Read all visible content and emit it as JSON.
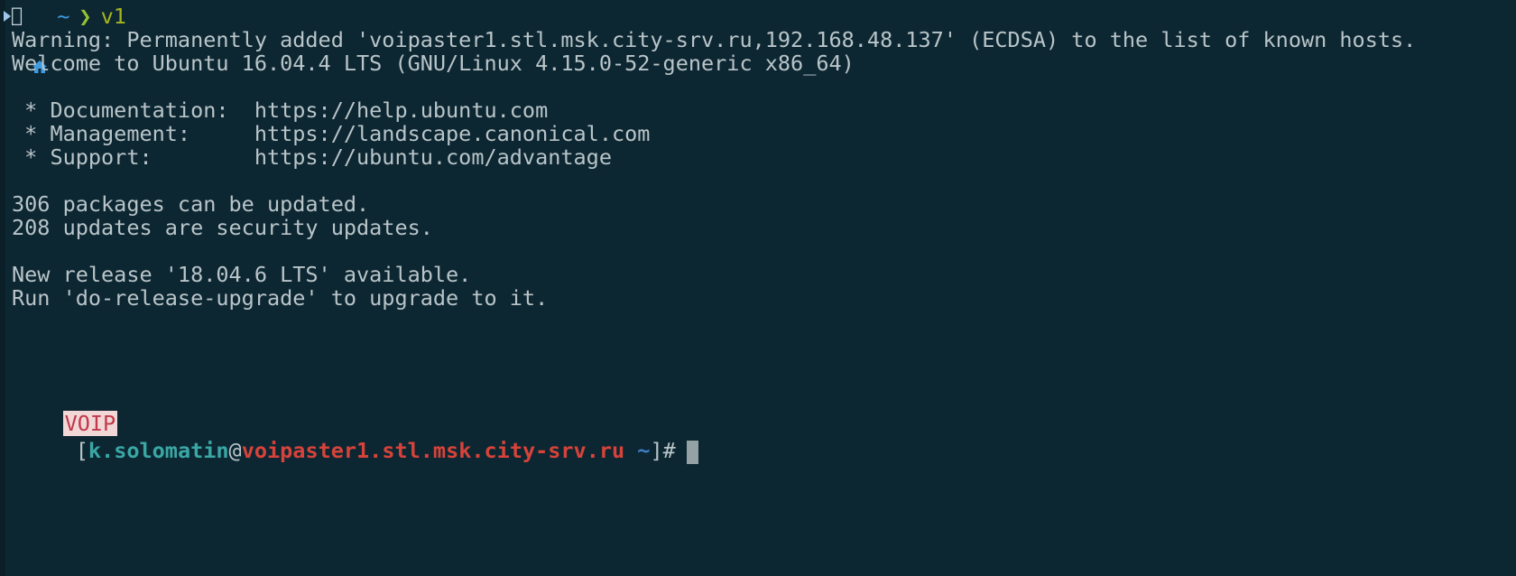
{
  "prompt_top": {
    "home_icon": "home-icon",
    "apple_icon": "apple-icon",
    "tilde": "~",
    "chevron": "❯",
    "branch": "v1"
  },
  "lines": [
    "Warning: Permanently added 'voipaster1.stl.msk.city-srv.ru,192.168.48.137' (ECDSA) to the list of known hosts.",
    "Welcome to Ubuntu 16.04.4 LTS (GNU/Linux 4.15.0-52-generic x86_64)",
    "",
    " * Documentation:  https://help.ubuntu.com",
    " * Management:     https://landscape.canonical.com",
    " * Support:        https://ubuntu.com/advantage",
    "",
    "306 packages can be updated.",
    "208 updates are security updates.",
    "",
    "New release '18.04.6 LTS' available.",
    "Run 'do-release-upgrade' to upgrade to it."
  ],
  "shell_prompt": {
    "badge": "VOIP",
    "open_bracket": "[",
    "user": "k.solomatin",
    "at": "@",
    "host": "voipaster1.stl.msk.city-srv.ru",
    "dir": " ~",
    "close": "]#"
  },
  "colors": {
    "background": "#0d2732",
    "text": "#b9c5c9",
    "user": "#3aa7a5",
    "host": "#d7433a",
    "badge_bg": "#f2d7d7",
    "badge_fg": "#c0394a"
  }
}
